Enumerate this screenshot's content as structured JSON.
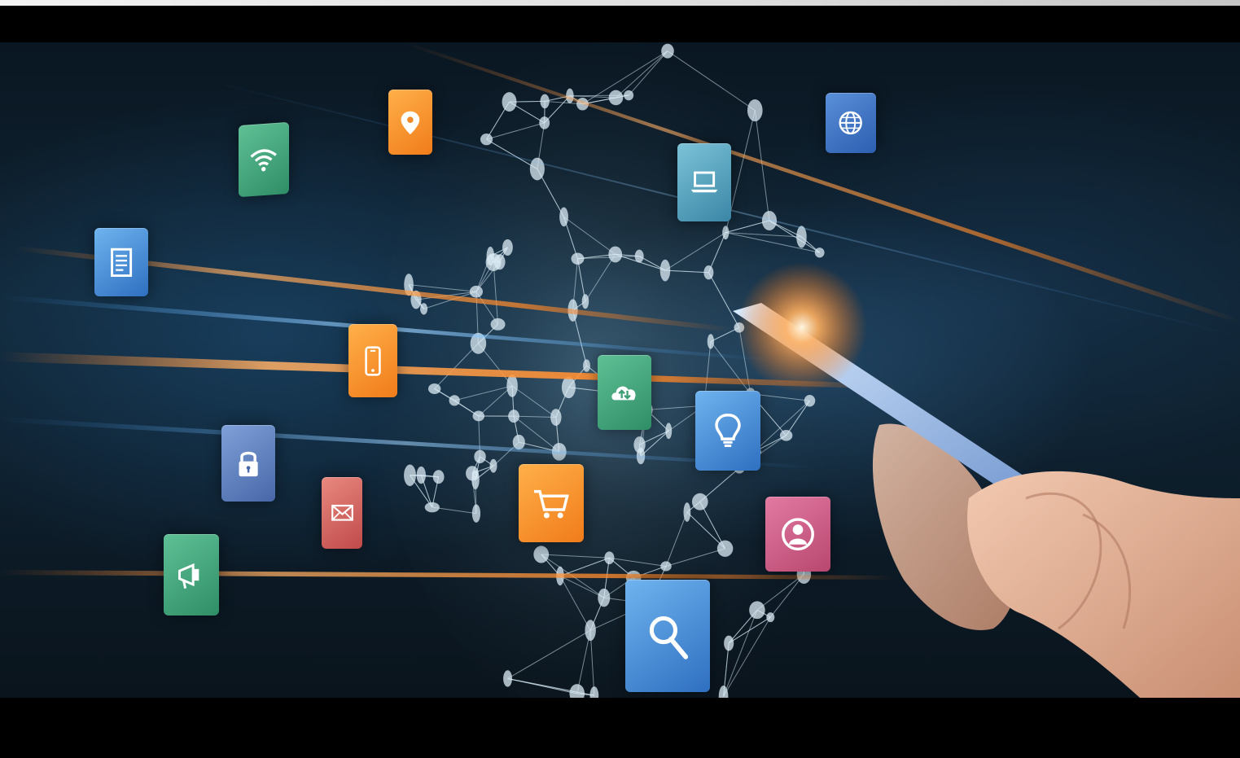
{
  "photo": {
    "subject": "stock-photo",
    "palette": {
      "background": "#0d1d2a",
      "glow": "#ff8a2a",
      "network": "#cfe3ef"
    }
  },
  "icons": [
    {
      "name": "wifi-icon",
      "color": "#3f9e76"
    },
    {
      "name": "location-pin-icon",
      "color": "#f59a2f"
    },
    {
      "name": "document-icon",
      "color": "#4a89d4"
    },
    {
      "name": "smartphone-icon",
      "color": "#f08a2b"
    },
    {
      "name": "lock-icon",
      "color": "#5b7fc4"
    },
    {
      "name": "mail-icon",
      "color": "#d06a6a"
    },
    {
      "name": "megaphone-icon",
      "color": "#3f9e76"
    },
    {
      "name": "laptop-icon",
      "color": "#4aa3c8"
    },
    {
      "name": "globe-icon",
      "color": "#4f86d6"
    },
    {
      "name": "cloud-transfer-icon",
      "color": "#3f9e76"
    },
    {
      "name": "lightbulb-icon",
      "color": "#3f86d6"
    },
    {
      "name": "shopping-cart-icon",
      "color": "#f08a2b"
    },
    {
      "name": "user-profile-icon",
      "color": "#d45f8a"
    },
    {
      "name": "search-icon",
      "color": "#4a8be0"
    }
  ]
}
